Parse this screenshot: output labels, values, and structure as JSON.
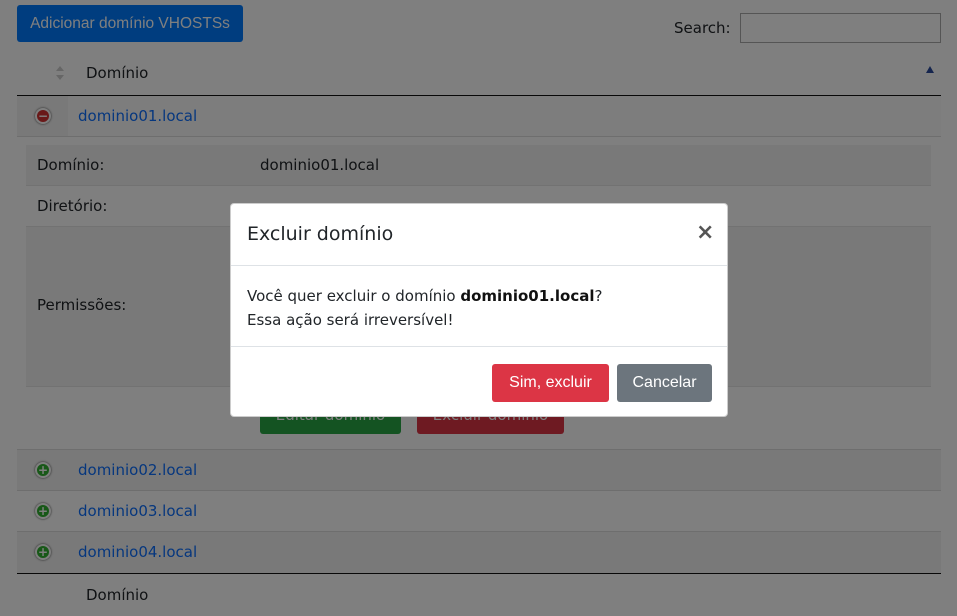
{
  "toolbar": {
    "add_button": "Adicionar domínio VHOSTSs"
  },
  "search": {
    "label": "Search:",
    "value": "",
    "placeholder": ""
  },
  "table": {
    "header_label": "Domínio",
    "footer_label": "Domínio",
    "rows": [
      {
        "domain": "dominio01.local",
        "expand_icon": "minus-circle-icon",
        "expand_glyph": "−"
      },
      {
        "domain": "dominio02.local",
        "expand_icon": "plus-circle-icon",
        "expand_glyph": "+"
      },
      {
        "domain": "dominio03.local",
        "expand_icon": "plus-circle-icon",
        "expand_glyph": "+"
      },
      {
        "domain": "dominio04.local",
        "expand_icon": "plus-circle-icon",
        "expand_glyph": "+"
      }
    ]
  },
  "detail": {
    "domain_label": "Domínio:",
    "domain_value": "dominio01.local",
    "directory_label": "Diretório:",
    "permissions_label": "Permissões:",
    "edit_button": "Editar domínio",
    "delete_button": "Excluir domínio"
  },
  "modal": {
    "title": "Excluir domínio",
    "close_glyph": "×",
    "message_prefix": "Você quer excluir o domínio ",
    "message_domain": "dominio01.local",
    "message_suffix": "?",
    "message_line2": "Essa ação será irreversível!",
    "confirm_button": "Sim, excluir",
    "cancel_button": "Cancelar"
  },
  "colors": {
    "primary": "#007bff",
    "danger": "#dc3545",
    "success": "#28a745",
    "secondary": "#6c757d",
    "link": "#0d6efd"
  }
}
